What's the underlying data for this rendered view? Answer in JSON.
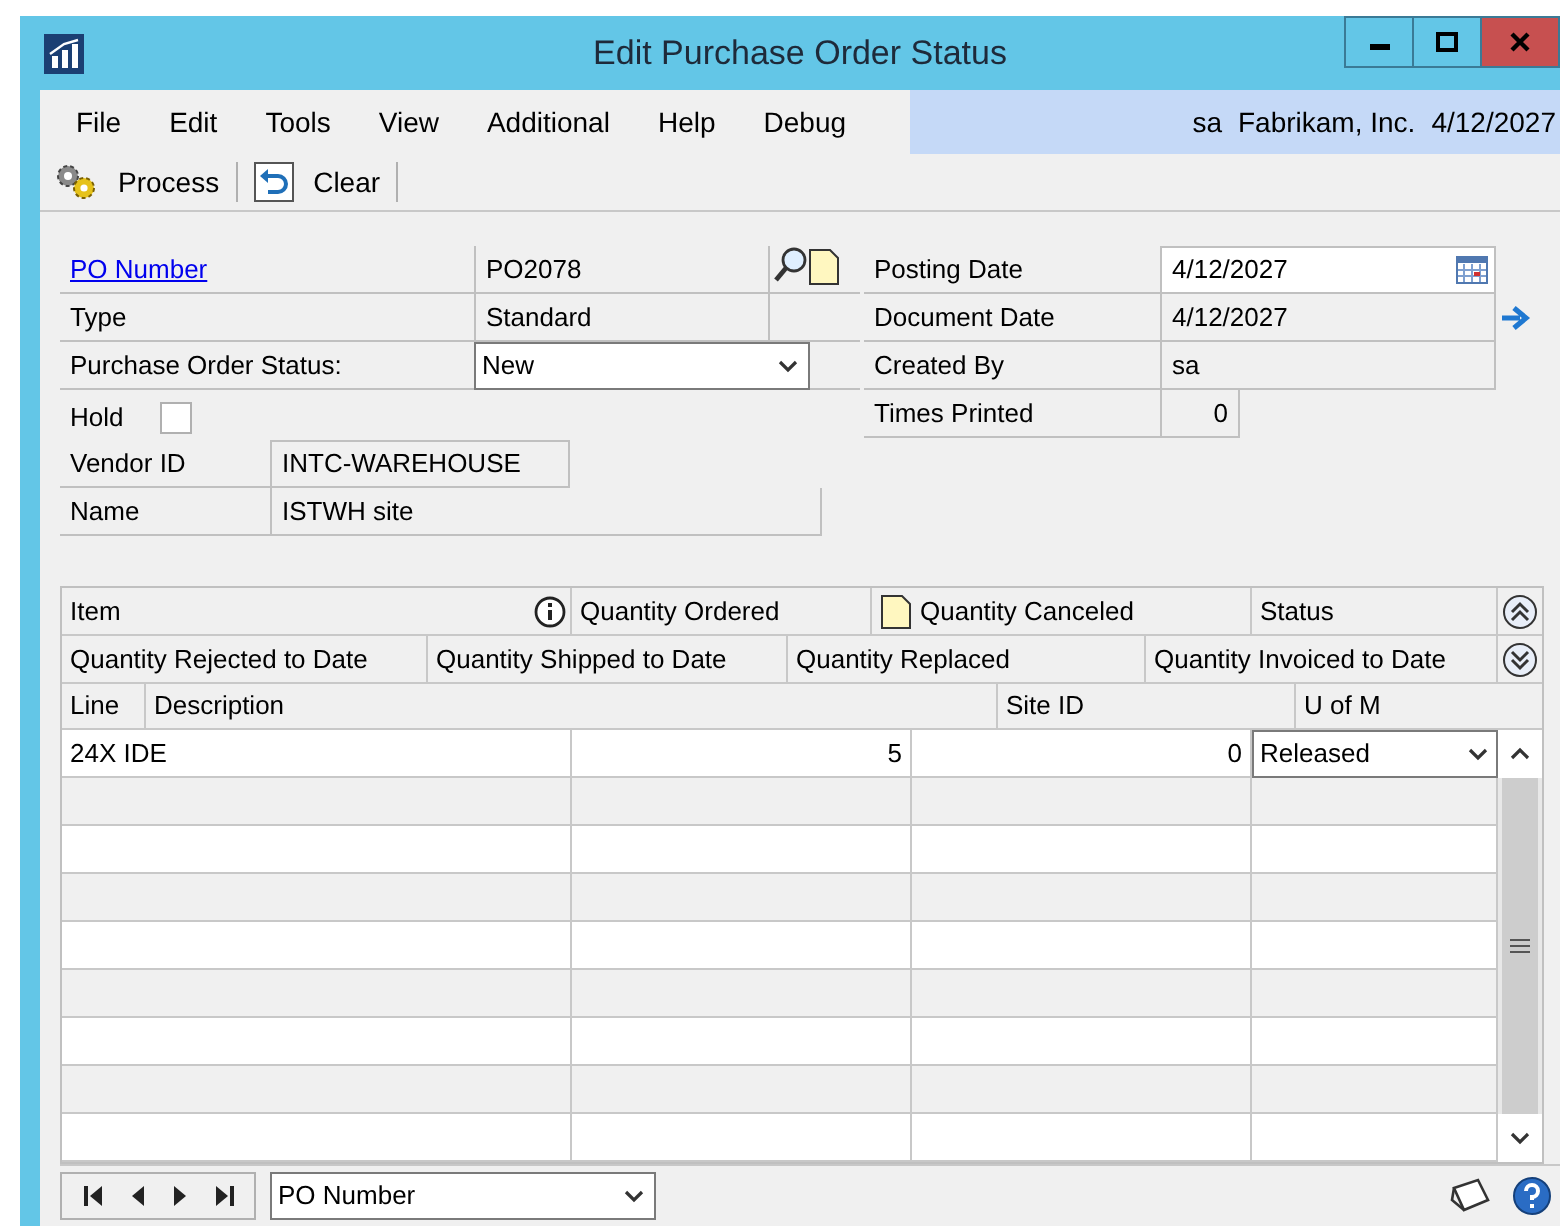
{
  "window": {
    "title": "Edit Purchase Order Status"
  },
  "menu": {
    "items": [
      "File",
      "Edit",
      "Tools",
      "View",
      "Additional",
      "Help",
      "Debug"
    ],
    "user": "sa",
    "company": "Fabrikam, Inc.",
    "date": "4/12/2027"
  },
  "toolbar": [
    {
      "kind": "process",
      "label": "Process"
    },
    {
      "kind": "clear",
      "label": "Clear"
    }
  ],
  "form": {
    "left": [
      {
        "label": "PO Number",
        "value": "PO2078",
        "kind": "lookup"
      },
      {
        "label": "Type",
        "value": "Standard",
        "kind": "readonly"
      },
      {
        "label": "Purchase Order Status:",
        "value": "New",
        "kind": "dropdown"
      }
    ],
    "right": [
      {
        "label": "Posting Date",
        "value": "4/12/2027",
        "kind": "date"
      },
      {
        "label": "Document Date",
        "value": "4/12/2027",
        "kind": "readonly-arrow"
      },
      {
        "label": "Created By",
        "value": "sa",
        "kind": "readonly"
      },
      {
        "label": "Times Printed",
        "value": "0",
        "kind": "number"
      }
    ],
    "hold": {
      "label": "Hold",
      "checked": false
    },
    "vendor_id": {
      "label": "Vendor ID",
      "value": "INTC-WAREHOUSE"
    },
    "name": {
      "label": "Name",
      "value": "ISTWH site"
    }
  },
  "grid": {
    "header_1": [
      "Item",
      "Quantity Ordered",
      "Quantity Canceled",
      "Status"
    ],
    "header_2": [
      "Quantity Rejected to Date",
      "Quantity Shipped to Date",
      "Quantity Replaced",
      "Quantity Invoiced to Date"
    ],
    "header_3": [
      "Line",
      "Description",
      "Site ID",
      "U of M"
    ],
    "rows": [
      {
        "item": "24X IDE",
        "quantity_ordered": "5",
        "quantity_canceled": "0",
        "status": "Released"
      }
    ]
  },
  "footer": {
    "sort_by": "PO Number"
  }
}
